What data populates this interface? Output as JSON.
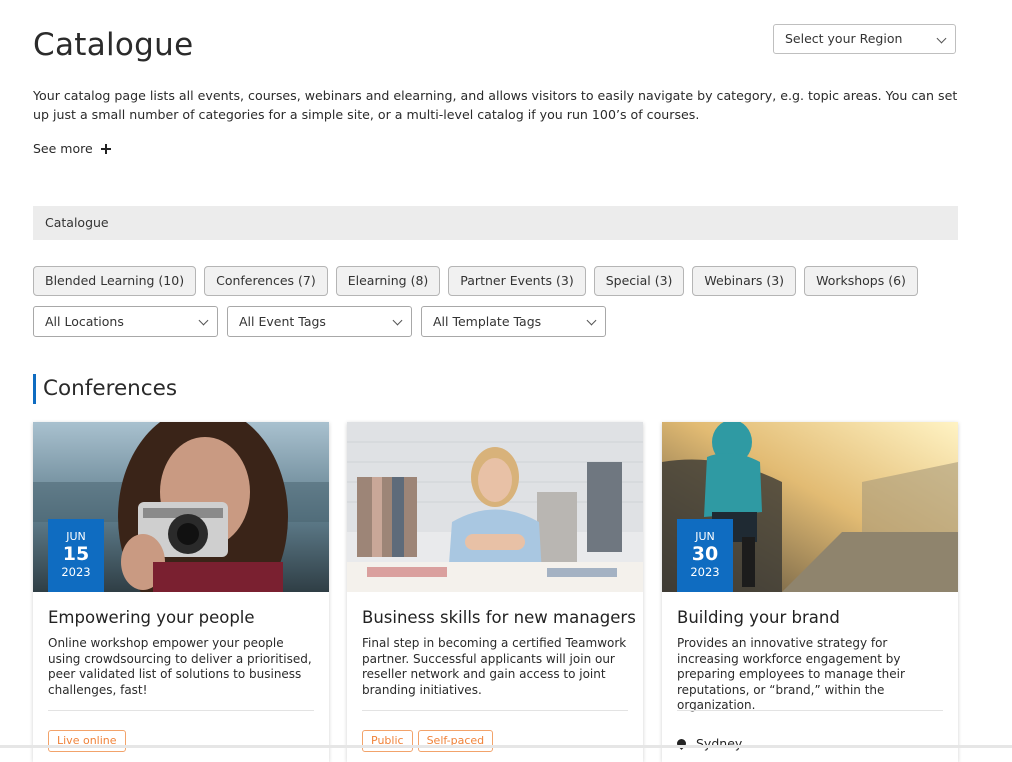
{
  "page": {
    "title": "Catalogue",
    "region_select": "Select your Region",
    "intro": "Your catalog page lists all events, courses, webinars and elearning, and allows visitors to easily navigate by category, e.g. topic areas. You can set up just a small number of categories for a simple site, or a multi-level catalog if you run 100’s of courses.",
    "see_more": "See more"
  },
  "breadcrumb": {
    "label": "Catalogue"
  },
  "categories": [
    {
      "label": "Blended Learning (10)"
    },
    {
      "label": "Conferences (7)"
    },
    {
      "label": "Elearning (8)"
    },
    {
      "label": "Partner Events (3)"
    },
    {
      "label": "Special (3)"
    },
    {
      "label": "Webinars (3)"
    },
    {
      "label": "Workshops (6)"
    }
  ],
  "filters": {
    "locations": "All Locations",
    "event_tags": "All Event Tags",
    "template_tags": "All Template Tags"
  },
  "section": {
    "title": "Conferences"
  },
  "cards": [
    {
      "title": "Empowering your people",
      "description": "Online workshop empower your people using crowdsourcing to deliver a prioritised, peer validated list of solutions to business challenges, fast!",
      "date": {
        "month": "JUN",
        "day": "15",
        "year": "2023"
      },
      "tags": [
        "Live online"
      ]
    },
    {
      "title": "Business skills for new managers",
      "description": "Final step in becoming a certified Teamwork partner. Successful applicants will join our reseller network and gain access to joint branding initiatives.",
      "tags": [
        "Public",
        "Self-paced"
      ]
    },
    {
      "title": "Building your brand",
      "description": "Provides an innovative strategy for increasing workforce engagement by preparing employees to manage their reputations, or “brand,” within the organization.",
      "date": {
        "month": "JUN",
        "day": "30",
        "year": "2023"
      },
      "location": "Sydney"
    }
  ],
  "colors": {
    "accent": "#0f6cc1",
    "tag": "#f0833a",
    "breadcrumb_bg": "#ececec"
  }
}
